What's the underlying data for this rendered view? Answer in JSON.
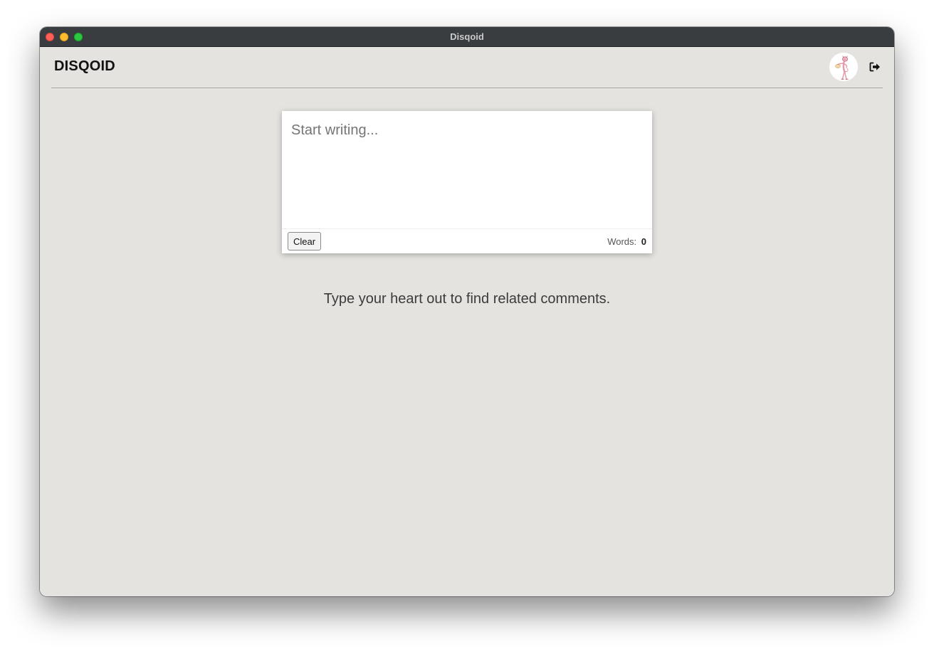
{
  "window": {
    "title": "Disqoid"
  },
  "header": {
    "brand": "DISQOID",
    "avatar_icon": "pink-panther-avatar",
    "logout_icon": "logout-icon"
  },
  "editor": {
    "placeholder": "Start writing...",
    "value": "",
    "clear_label": "Clear",
    "words_label": "Words:",
    "words_count": "0"
  },
  "main": {
    "hint": "Type your heart out to find related comments."
  },
  "colors": {
    "titlebar": "#3a3d40",
    "background": "#e5e3df",
    "close": "#fe5f57",
    "minimize": "#febc2e",
    "maximize": "#28c840"
  }
}
